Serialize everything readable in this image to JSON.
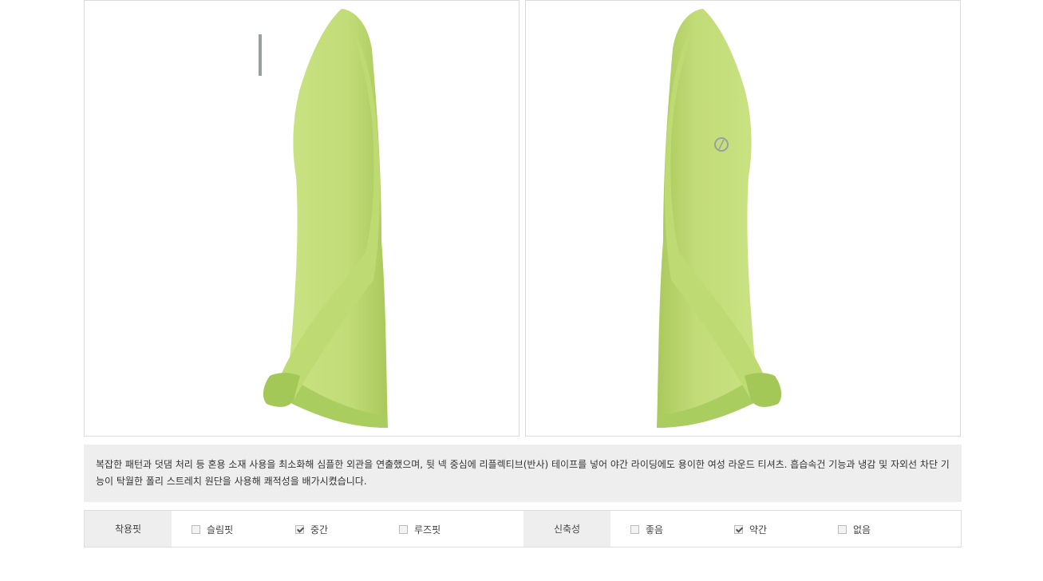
{
  "product": {
    "images": [
      {
        "name": "long-sleeve-tee-left-side",
        "alt": "",
        "color": "#c5de7a"
      },
      {
        "name": "long-sleeve-tee-right-side",
        "alt": "",
        "color": "#c5de7a"
      }
    ],
    "description": "복잡한 패턴과 덧댐 처리 등 혼용 소재 사용을 최소화해 심플한 외관을 연출했으며, 뒷 넥 중심에 리플렉티브(반사) 테이프를 넣어 야간 라이딩에도 용이한 여성 라운드 티셔츠. 흡습속건 기능과 냉감 및 자외선 차단 기능이 탁월한 폴리 스트레치 원단을 사용해 쾌적성을 배가시켰습니다."
  },
  "spec": {
    "fit": {
      "label": "착용핏",
      "options": [
        {
          "label": "슬림핏",
          "checked": false
        },
        {
          "label": "중간",
          "checked": true
        },
        {
          "label": "루즈핏",
          "checked": false
        }
      ]
    },
    "stretch": {
      "label": "신축성",
      "options": [
        {
          "label": "좋음",
          "checked": false
        },
        {
          "label": "약간",
          "checked": true
        },
        {
          "label": "없음",
          "checked": false
        }
      ]
    }
  }
}
